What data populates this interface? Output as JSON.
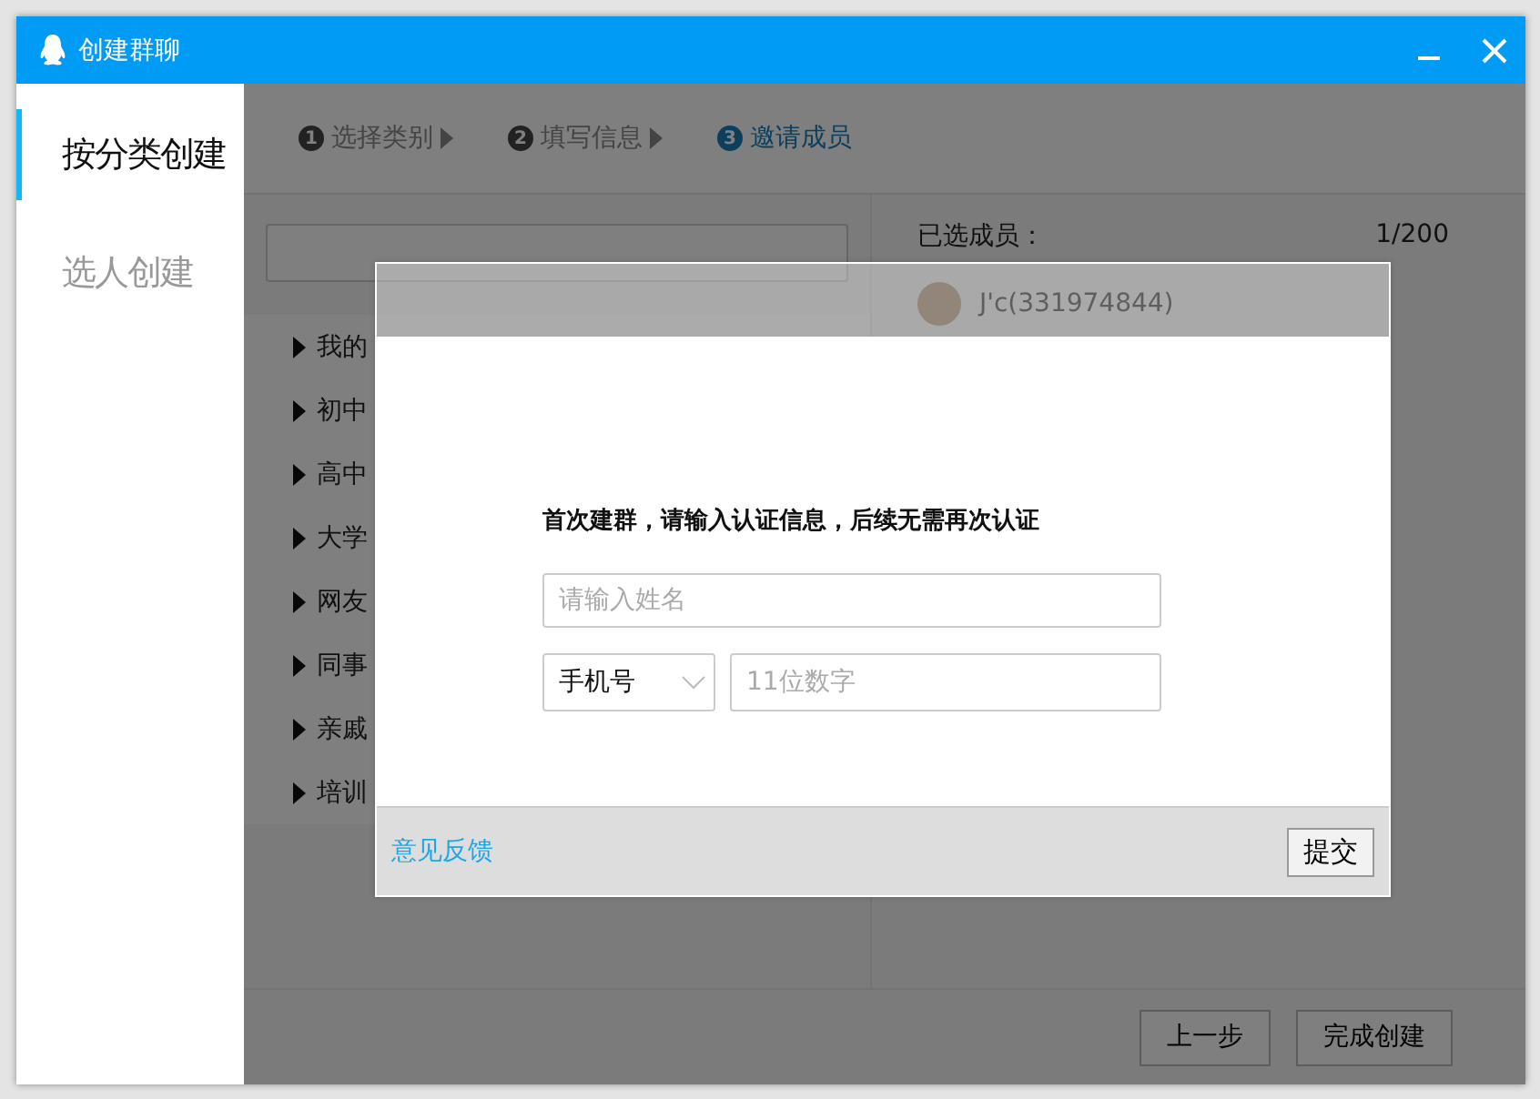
{
  "window": {
    "title": "创建群聊"
  },
  "sidebar": {
    "items": [
      {
        "label": "按分类创建",
        "selected": true
      },
      {
        "label": "选人创建",
        "selected": false
      }
    ]
  },
  "steps": [
    {
      "number": "1",
      "label": "选择类别",
      "selected": false
    },
    {
      "number": "2",
      "label": "填写信息",
      "selected": false
    },
    {
      "number": "3",
      "label": "邀请成员",
      "selected": true
    }
  ],
  "groups": [
    {
      "label": "我的",
      "expanded": false
    },
    {
      "label": "初中",
      "expanded": false
    },
    {
      "label": "高中",
      "expanded": false
    },
    {
      "label": "大学",
      "expanded": false
    },
    {
      "label": "网友",
      "expanded": false
    },
    {
      "label": "同事",
      "expanded": false
    },
    {
      "label": "亲戚",
      "expanded": false
    },
    {
      "label": "培训",
      "expanded": false
    }
  ],
  "selected_members": {
    "heading": "已选成员：",
    "count": "1/200",
    "members": [
      {
        "name": "J'c(331974844)"
      }
    ]
  },
  "buttons": [
    {
      "label": "上一步"
    },
    {
      "label": "完成创建"
    }
  ],
  "dialog": {
    "message": "首次建群，请输入认证信息，后续无需再次认证",
    "name_field": {
      "placeholder": "请输入姓名"
    },
    "id_type": {
      "value": "手机号"
    },
    "phone_field": {
      "placeholder": "11位数字"
    },
    "feedback_link": "意见反馈",
    "submit": "提交"
  }
}
